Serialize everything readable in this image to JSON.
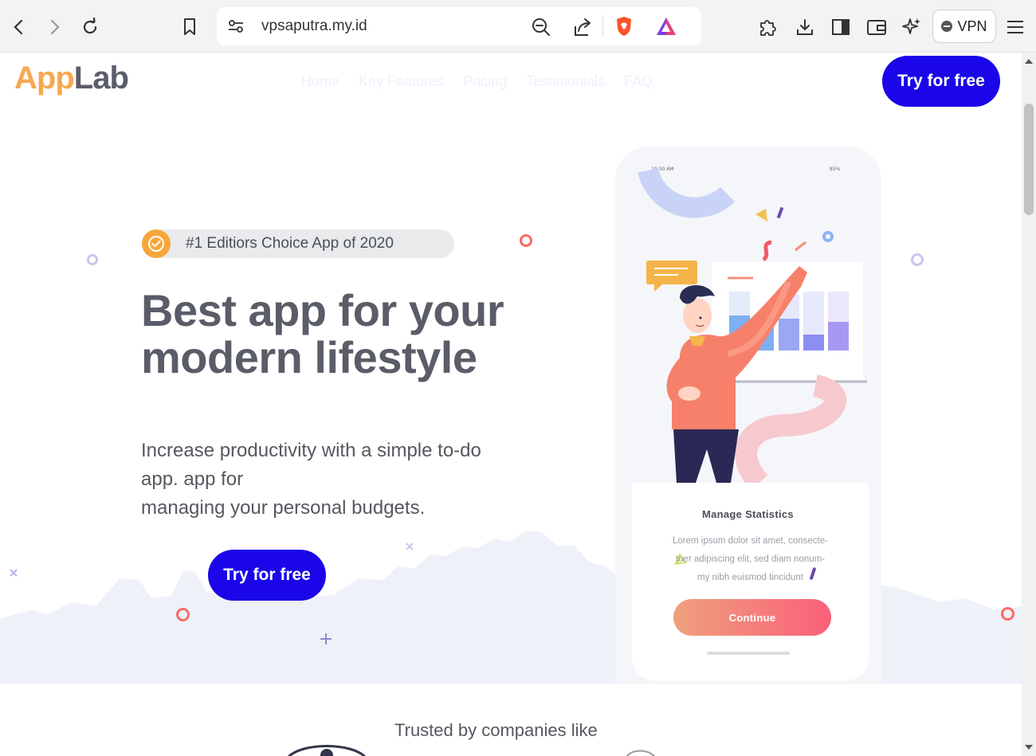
{
  "browser": {
    "url": "vpsaputra.my.id",
    "vpn_label": "VPN"
  },
  "site": {
    "logo_part1": "App",
    "logo_part2": "Lab",
    "nav_items": [
      "Home",
      "Key Features",
      "Pricing",
      "Testimonials",
      "FAQ"
    ],
    "cta_top": "Try for free"
  },
  "hero": {
    "badge_text": "#1 Editiors Choice App of 2020",
    "headline_line1": "Best app for your",
    "headline_line2": "modern lifestyle",
    "sub_line1": "Increase productivity with a simple to-do",
    "sub_line2": "app. app for",
    "sub_line3": "managing your personal budgets.",
    "cta": "Try for free"
  },
  "phone": {
    "time": "10:30 AM",
    "battery": "85%",
    "card_title": "Manage Statistics",
    "card_body_line1": "Lorem ipsum dolor sit amet, consecte-",
    "card_body_line2": "tuer adipiscing elit, sed diam nonum-",
    "card_body_line3": "my nibh euismod tincidunt",
    "continue_label": "Continue"
  },
  "trusted": {
    "heading": "Trusted by companies like"
  },
  "colors": {
    "accent": "#1a06e8",
    "logo_orange": "#f6a94f",
    "logo_gray": "#5b5d6b",
    "coral": "#f96b66"
  }
}
